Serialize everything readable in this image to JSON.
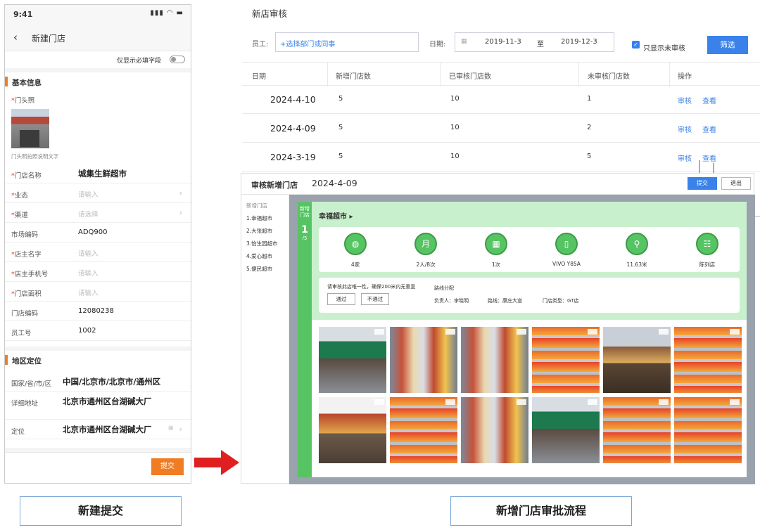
{
  "phone": {
    "time": "9:41",
    "nav_title": "新建门店",
    "toggle_label": "仅显示必填字段",
    "section_basic": "基本信息",
    "photo_label": "门头照",
    "photo_caption": "门头照拍照说明文字",
    "fields": [
      {
        "label": "门店名称",
        "required": true,
        "value": "城集生鲜超市",
        "placeholder": ""
      },
      {
        "label": "业态",
        "required": true,
        "value": "",
        "placeholder": "请输入"
      },
      {
        "label": "渠道",
        "required": true,
        "value": "",
        "placeholder": "请选择"
      },
      {
        "label": "市场编码",
        "required": false,
        "value": "ADQ900",
        "placeholder": ""
      },
      {
        "label": "店主名字",
        "required": true,
        "value": "",
        "placeholder": "请输入"
      },
      {
        "label": "店主手机号",
        "required": true,
        "value": "",
        "placeholder": "请输入"
      },
      {
        "label": "门店面积",
        "required": true,
        "value": "",
        "placeholder": "请输入"
      },
      {
        "label": "门店编码",
        "required": false,
        "value": "12080238",
        "placeholder": ""
      },
      {
        "label": "员工号",
        "required": false,
        "value": "1002",
        "placeholder": ""
      }
    ],
    "section_region": "地区定位",
    "region": [
      {
        "label": "国家/省/市/区",
        "value": "中国/北京市/北京市/通州区"
      },
      {
        "label": "详细地址",
        "value": "北京市通州区台湖碱大厂"
      },
      {
        "label": "定位",
        "value": "北京市通州区台湖碱大厂"
      }
    ],
    "submit_label": "提交"
  },
  "captions": {
    "left": "新建提交",
    "right": "新增门店审批流程"
  },
  "review": {
    "title": "新店审核",
    "employee_label": "员工:",
    "employee_placeholder": "+选择部门或同事",
    "date_label": "日期:",
    "date_from": "2019-11-3",
    "date_to_word": "至",
    "date_to": "2019-12-3",
    "only_unreviewed": "只显示未审核",
    "filter_button": "筛选",
    "columns": [
      "日期",
      "新增门店数",
      "已审核门店数",
      "未审核门店数",
      "操作"
    ],
    "rows": [
      {
        "date": "2024-4-10",
        "new": "5",
        "reviewed": "10",
        "pending": "1"
      },
      {
        "date": "2024-4-09",
        "new": "5",
        "reviewed": "10",
        "pending": "2"
      },
      {
        "date": "2024-3-19",
        "new": "5",
        "reviewed": "10",
        "pending": "5"
      }
    ],
    "action_review": "审核",
    "action_view": "查看"
  },
  "dialog": {
    "title": "审核新增门店",
    "date": "2024-4-09",
    "submit": "提交",
    "exit": "退出",
    "side_title": "新增门店",
    "stores": [
      "1.幸福超市",
      "2.大张超市",
      "3.怡生园超市",
      "4.爱心超市",
      "5.便民超市"
    ],
    "badge_text": "新增门店",
    "badge_num": "1",
    "badge_total": "/5",
    "store_name": "幸福超市 ▸",
    "stats": [
      {
        "icon": "globe-icon",
        "glyph": "◍",
        "label": "4家"
      },
      {
        "icon": "calendar-month-icon",
        "glyph": "月",
        "label": "2人/8次"
      },
      {
        "icon": "calendar-day-icon",
        "glyph": "▦",
        "label": "1次"
      },
      {
        "icon": "phone-icon",
        "glyph": "▯",
        "label": "VIVO Y85A"
      },
      {
        "icon": "map-pin-icon",
        "glyph": "⚲",
        "label": "11.63米"
      },
      {
        "icon": "store-type-icon",
        "glyph": "☷",
        "label": "陈列店"
      }
    ],
    "notice": "请审核此店唯一性，确保200米内无重复",
    "approve": "通过",
    "reject": "不通过",
    "route_title": "路线分配",
    "owner": "负责人：李晓明",
    "route": "路线：康庄大道",
    "store_type": "门店类型：GT店",
    "images": [
      "storefront-photo",
      "aisle-photo",
      "aisle-photo",
      "shelf-photo",
      "produce-photo",
      "shelf-photo",
      "storefront-inside-photo",
      "shelf-photo",
      "aisle-photo",
      "storefront-photo",
      "shelf-photo",
      "shelf-photo"
    ]
  }
}
